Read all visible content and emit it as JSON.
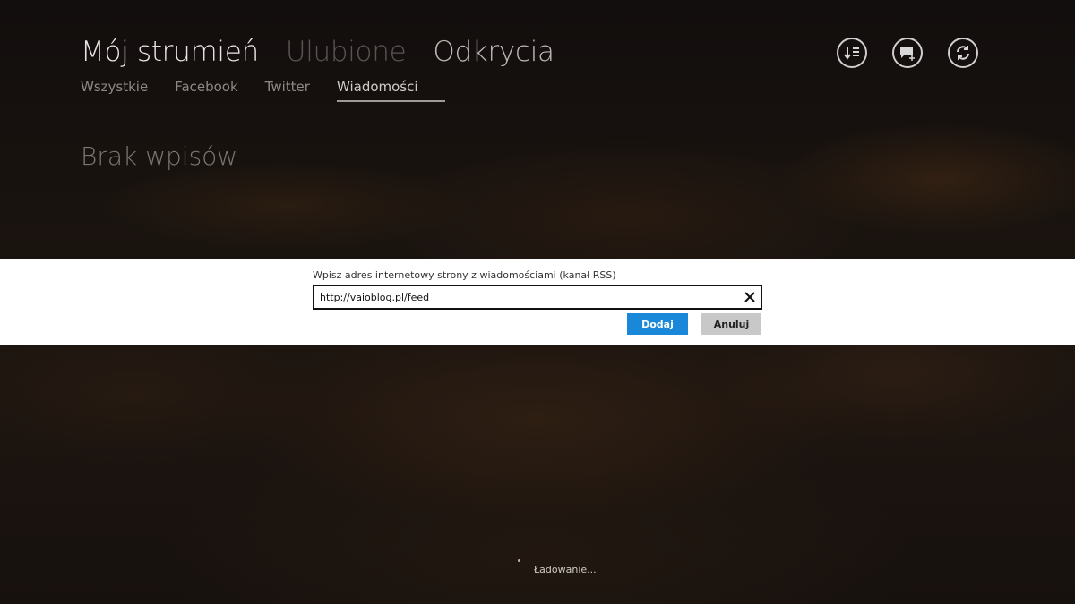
{
  "header": {
    "pivots": [
      {
        "label": "Mój strumień"
      },
      {
        "label": "Ulubione"
      },
      {
        "label": "Odkrycia"
      }
    ],
    "subtabs": [
      {
        "label": "Wszystkie"
      },
      {
        "label": "Facebook"
      },
      {
        "label": "Twitter"
      },
      {
        "label": "Wiadomości"
      }
    ],
    "appbar_icons": [
      "sort-list-icon",
      "add-comment-icon",
      "refresh-icon"
    ]
  },
  "main": {
    "empty_message": "Brak wpisów"
  },
  "dialog": {
    "label": "Wpisz adres internetowy strony z wiadomościami (kanał RSS)",
    "url_value": "http://vaioblog.pl/feed",
    "add_label": "Dodaj",
    "cancel_label": "Anuluj",
    "accent_color": "#1a88d8"
  },
  "status": {
    "loading_text": "Ładowanie..."
  }
}
